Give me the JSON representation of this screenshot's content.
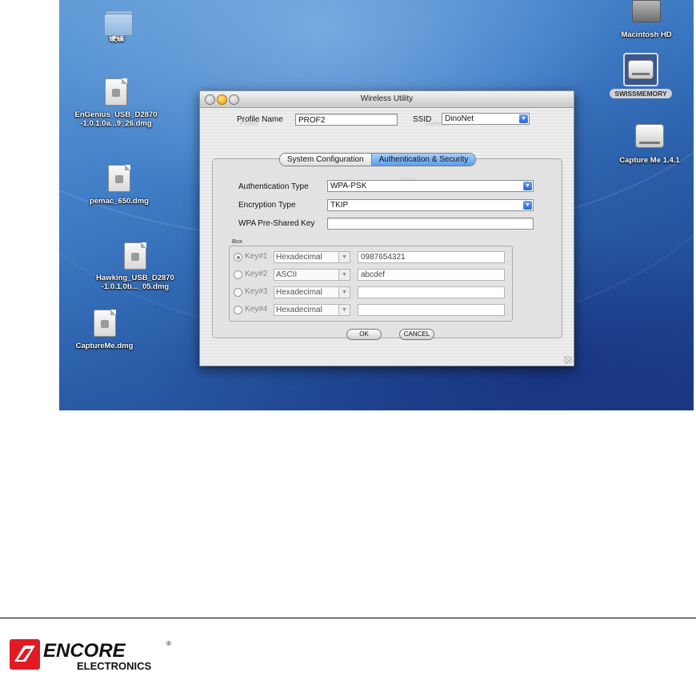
{
  "desktop": {
    "icons_left": [
      {
        "label": "硬碟",
        "kind": "folder"
      },
      {
        "label": "EnGenius_USB_D2870\n-1.0.1.0a...9_26.dmg",
        "kind": "dmg"
      },
      {
        "label": "pemac_650.dmg",
        "kind": "dmg"
      },
      {
        "label": "Hawking_USB_D2870\n-1.0.1.0b..._05.dmg",
        "kind": "dmg"
      },
      {
        "label": "CaptureMe.dmg",
        "kind": "dmg"
      }
    ],
    "icons_right": [
      {
        "label": "Macintosh HD",
        "kind": "hard-drive"
      },
      {
        "label": "SWISSMEMORY",
        "kind": "usb-drive"
      },
      {
        "label": "Capture Me 1.4.1",
        "kind": "disk-image-volume"
      }
    ]
  },
  "window": {
    "title": "Wireless Utility",
    "profile_name_label": "Profile Name",
    "profile_name_value": "PROF2",
    "ssid_label": "SSID",
    "ssid_value": "DinoNet",
    "tabs": [
      {
        "label": "System Configuration",
        "active": false
      },
      {
        "label": "Authentication & Security",
        "active": true
      }
    ],
    "auth_type_label": "Authentication Type",
    "auth_type_value": "WPA-PSK",
    "enc_type_label": "Encryption Type",
    "enc_type_value": "TKIP",
    "psk_label": "WPA Pre-Shared Key",
    "psk_value": "",
    "box_title": "Box",
    "keys": [
      {
        "label": "Key#1",
        "format": "Hexadecimal",
        "value": "0987654321",
        "selected": true
      },
      {
        "label": "Key#2",
        "format": "ASCII",
        "value": "abcdef",
        "selected": false
      },
      {
        "label": "Key#3",
        "format": "Hexadecimal",
        "value": "",
        "selected": false
      },
      {
        "label": "Key#4",
        "format": "Hexadecimal",
        "value": "",
        "selected": false
      }
    ],
    "ok_label": "OK",
    "cancel_label": "CANCEL"
  },
  "footer": {
    "brand_name": "ENCORE",
    "brand_sub": "ELECTRONICS",
    "brand_mark": "®",
    "brand_color": "#e21b23"
  }
}
